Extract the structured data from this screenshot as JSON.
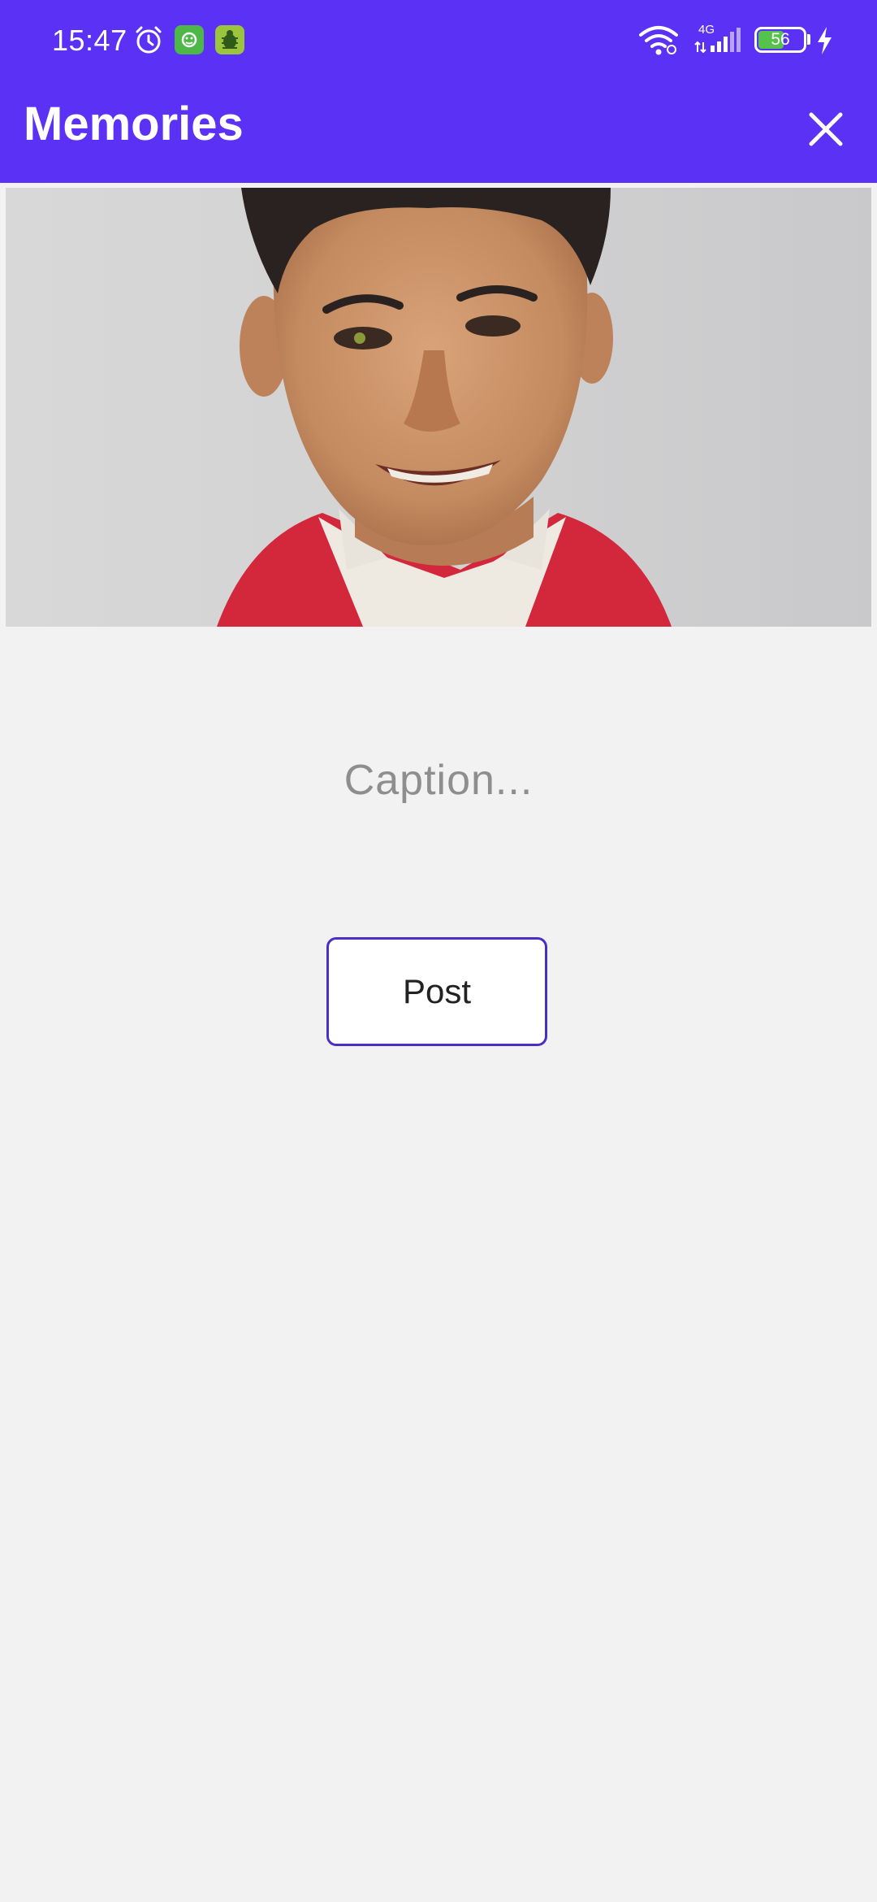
{
  "status_bar": {
    "time": "15:47",
    "network": "4G",
    "battery": "56",
    "icons": [
      "alarm-icon",
      "green-app-icon",
      "bug-app-icon",
      "wifi-icon",
      "signal-icon",
      "battery-icon",
      "charging-icon"
    ]
  },
  "app_bar": {
    "title": "Memories",
    "close_icon": "close-icon"
  },
  "photo": {
    "subject": "portrait-photo"
  },
  "caption": {
    "placeholder": "Caption..."
  },
  "post_button": {
    "label": "Post"
  },
  "colors": {
    "primary": "#5b32f5",
    "button_border": "#4b2fc4",
    "background": "#f2f2f2",
    "placeholder": "#8e8e8e"
  }
}
